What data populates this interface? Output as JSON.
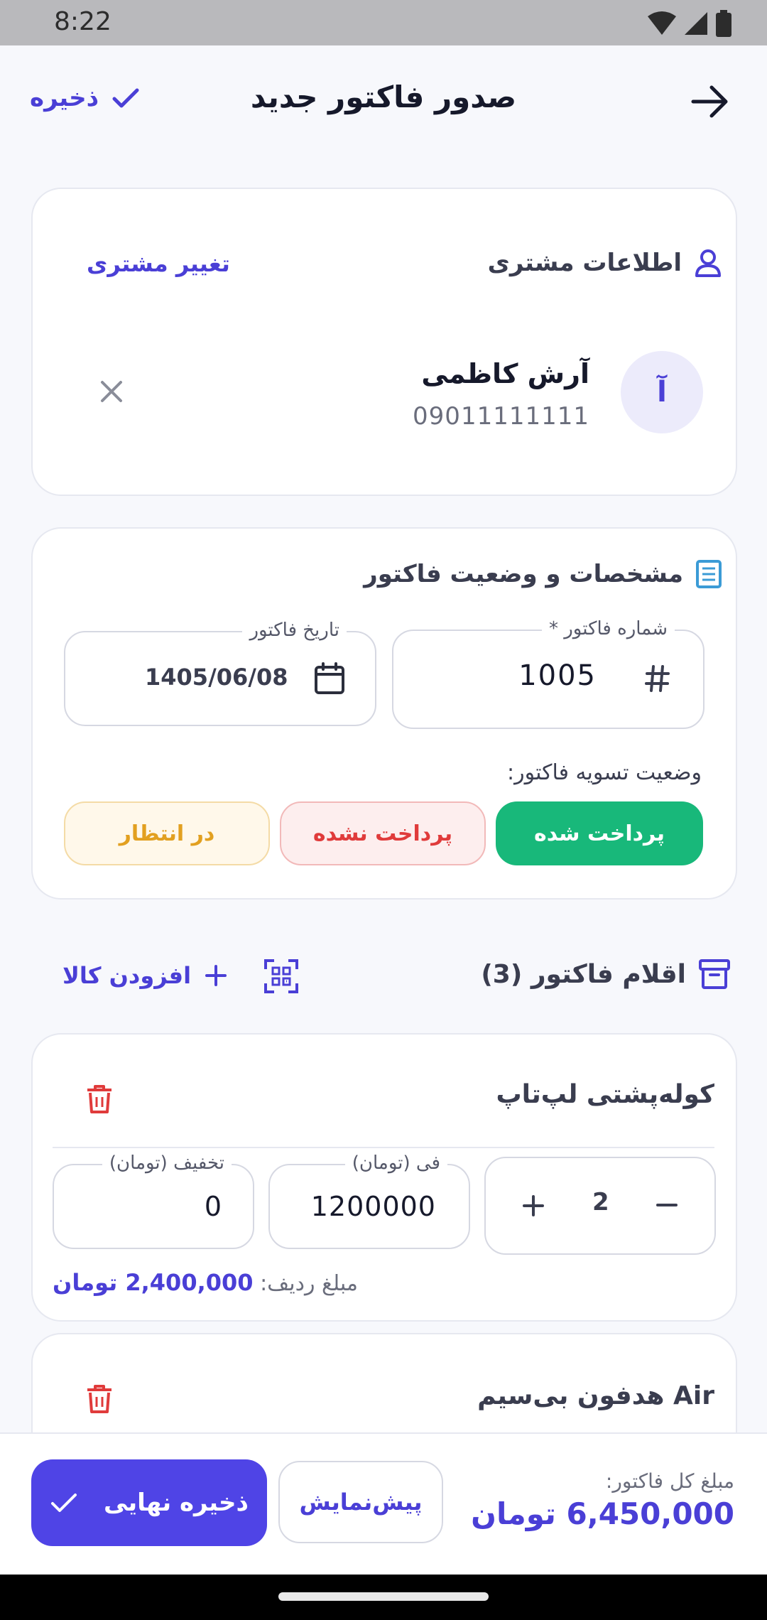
{
  "status_bar": {
    "time": "8:22"
  },
  "header": {
    "title": "صدور فاکتور جدید",
    "save_label": "ذخیره"
  },
  "customer": {
    "section_title": "اطلاعات مشتری",
    "change_label": "تغییر مشتری",
    "avatar_letter": "آ",
    "name": "آرش کاظمی",
    "phone": "09011111111"
  },
  "details": {
    "section_title": "مشخصات و وضعیت فاکتور",
    "invoice_number_label": "شماره فاکتور *",
    "invoice_number": "1005",
    "date_label": "تاریخ فاکتور",
    "date": "1405/06/08",
    "settlement_label": "وضعیت تسویه فاکتور:",
    "status_options": [
      "پرداخت شده",
      "پرداخت نشده",
      "در انتظار"
    ],
    "selected_status": "پرداخت شده"
  },
  "items": {
    "section_title": "اقلام فاکتور (3)",
    "add_label": "افزودن کالا",
    "list": [
      {
        "name": "کوله‌پشتی لپ‌تاپ",
        "quantity": "2",
        "price_label": "فی (تومان)",
        "price": "1200000",
        "discount_label": "تخفیف (تومان)",
        "discount": "0",
        "row_total_label": "مبلغ ردیف:",
        "row_total": "2,400,000 تومان"
      },
      {
        "name": "هدفون بی‌سیم Air"
      }
    ]
  },
  "footer": {
    "total_label": "مبلغ کل فاکتور:",
    "total": "6,450,000 تومان",
    "preview_label": "پیش‌نمایش",
    "final_save_label": "ذخیره نهایی"
  },
  "colors": {
    "accent": "#4a3fd6",
    "paid": "#18b87a",
    "unpaid": "#e03b3b",
    "pending": "#e2a020"
  }
}
